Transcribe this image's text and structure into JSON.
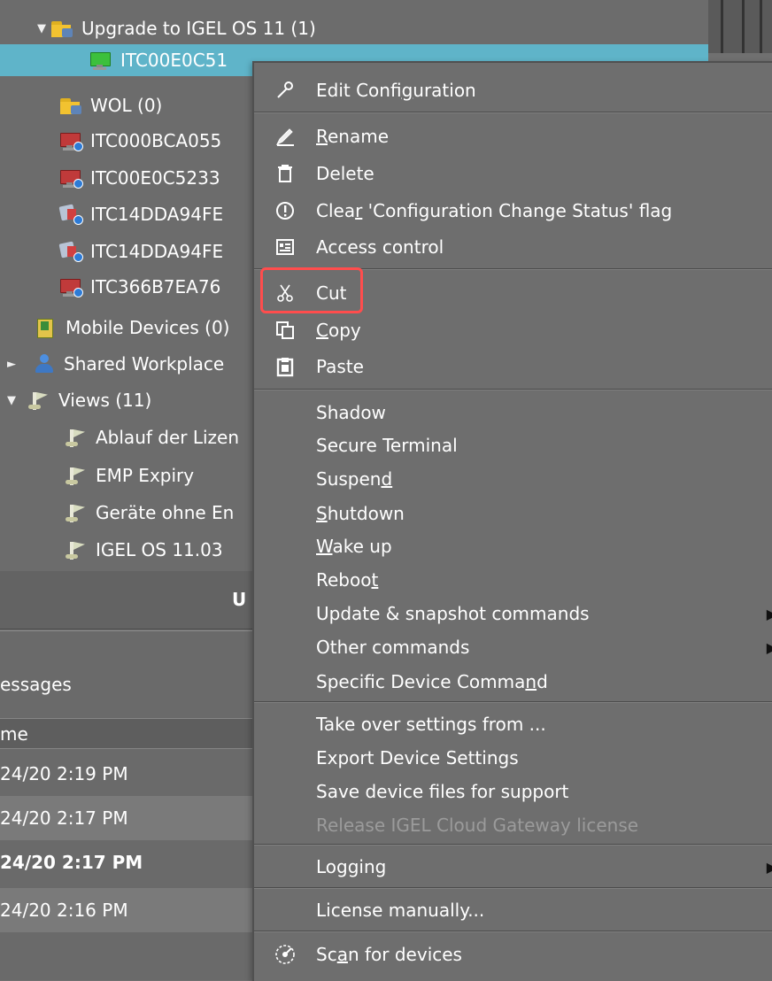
{
  "tree": {
    "items": [
      {
        "expander": "▼",
        "label": "Upgrade to IGEL OS 11 (1)"
      },
      {
        "label": "ITC00E0C51"
      },
      {
        "label": "WOL (0)"
      },
      {
        "label": "ITC000BCA055"
      },
      {
        "label": "ITC00E0C5233"
      },
      {
        "label": "ITC14DDA94FE"
      },
      {
        "label": "ITC14DDA94FE"
      },
      {
        "label": "ITC366B7EA76"
      },
      {
        "label": "Mobile Devices (0)"
      },
      {
        "expander": "►",
        "label": "Shared Workplace"
      },
      {
        "expander": "▼",
        "label": "Views (11)"
      },
      {
        "label": "Ablauf der Lizen"
      },
      {
        "label": "EMP Expiry"
      },
      {
        "label": "Geräte ohne En"
      },
      {
        "label": "IGEL OS 11.03"
      }
    ]
  },
  "band": {
    "label": "U"
  },
  "messages": {
    "title": "essages",
    "column_header": "me",
    "rows": [
      "24/20 2:19 PM",
      "24/20 2:17 PM",
      "24/20 2:17 PM",
      "24/20 2:16 PM"
    ]
  },
  "menu": {
    "edit_configuration": {
      "pre": "Edit Confi",
      "u": "g",
      "post": "uration"
    },
    "rename": {
      "pre": "",
      "u": "R",
      "post": "ename"
    },
    "delete": "Delete",
    "clear_flag": {
      "pre": "Clea",
      "u": "r",
      "post": " 'Configuration Change Status' flag"
    },
    "access_control": "Access control",
    "cut": "Cut",
    "copy": {
      "pre": "",
      "u": "C",
      "post": "opy"
    },
    "paste": "Paste",
    "shadow": "Shadow",
    "secure_terminal": "Secure Terminal",
    "suspend": {
      "pre": "Suspen",
      "u": "d",
      "post": ""
    },
    "shutdown": {
      "pre": "",
      "u": "S",
      "post": "hutdown"
    },
    "wake_up": {
      "pre": "",
      "u": "W",
      "post": "ake up"
    },
    "reboot": {
      "pre": "Reboo",
      "u": "t",
      "post": ""
    },
    "update_snapshot": "Update & snapshot commands",
    "other_commands": "Other commands",
    "specific_device_command": {
      "pre": "Specific Device Comma",
      "u": "n",
      "post": "d"
    },
    "take_over_settings": "Take over settings from ...",
    "export_device_settings": "Export Device Settings",
    "save_device_files": "Save device files for support",
    "release_license": "Release IGEL Cloud Gateway license",
    "logging": "Logging",
    "license_manually": "License manually...",
    "scan_for_devices": {
      "pre": "Sc",
      "u": "a",
      "post": "n for devices"
    },
    "submenu_arrow": "▶"
  },
  "colors": {
    "menu_bg": "#6e6e6e",
    "tree_bg": "#6c6c6c",
    "selection": "#5fb4c9",
    "highlight_box": "#ff4d4d",
    "disabled_text": "#9b9b9b"
  }
}
